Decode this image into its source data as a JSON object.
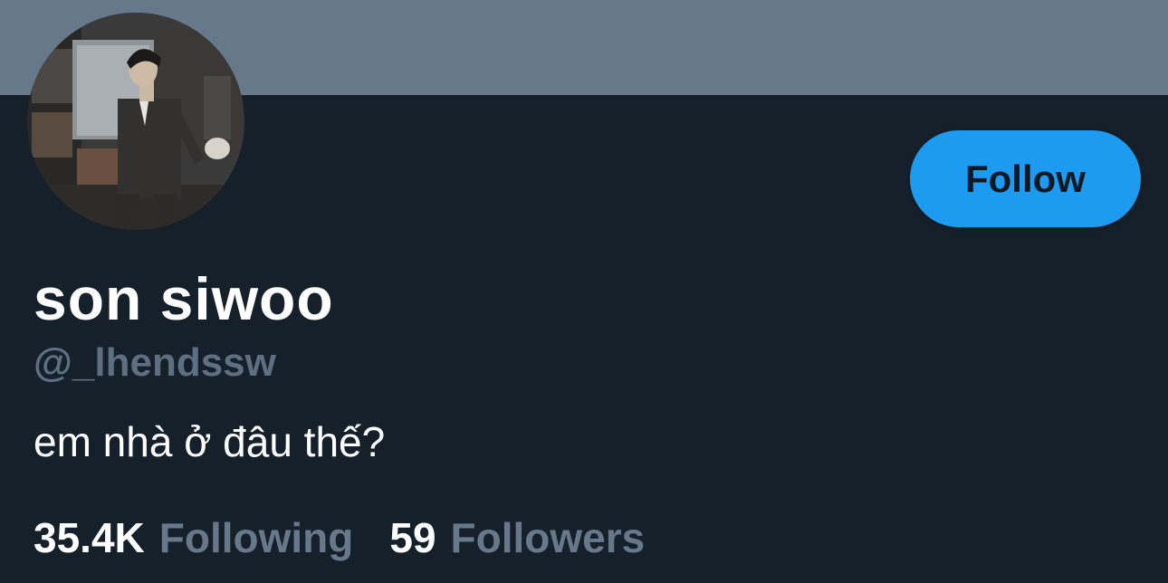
{
  "profile": {
    "display_name": "son siwoo",
    "handle": "@_lhendssw",
    "bio": "em nhà ở đâu thế?",
    "follow_label": "Follow"
  },
  "stats": {
    "following_count": "35.4K",
    "following_label": "Following",
    "followers_count": "59",
    "followers_label": "Followers"
  },
  "colors": {
    "banner": "#66788a",
    "background": "#16202b",
    "accent": "#1d9bf0",
    "muted_text": "#66788a"
  },
  "icons": {
    "avatar": "profile-photo"
  }
}
